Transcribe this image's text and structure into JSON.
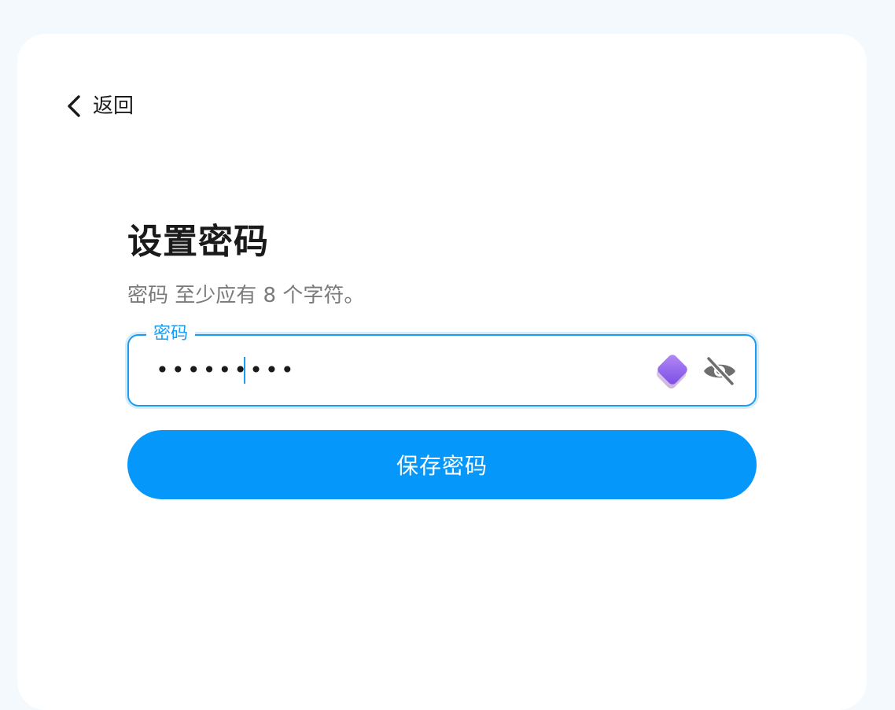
{
  "back": {
    "label": "返回"
  },
  "form": {
    "title": "设置密码",
    "subtitle": "密码 至少应有 8 个字符。",
    "password_field": {
      "label": "密码",
      "value": "•••••••••"
    },
    "save_label": "保存密码"
  },
  "colors": {
    "accent": "#0598fa",
    "field_border": "#1a9cf0",
    "page_bg": "#f3f9fd",
    "card_bg": "#ffffff"
  },
  "icons": {
    "back": "chevron-left-icon",
    "password_manager": "password-manager-icon",
    "visibility": "eye-off-icon"
  }
}
